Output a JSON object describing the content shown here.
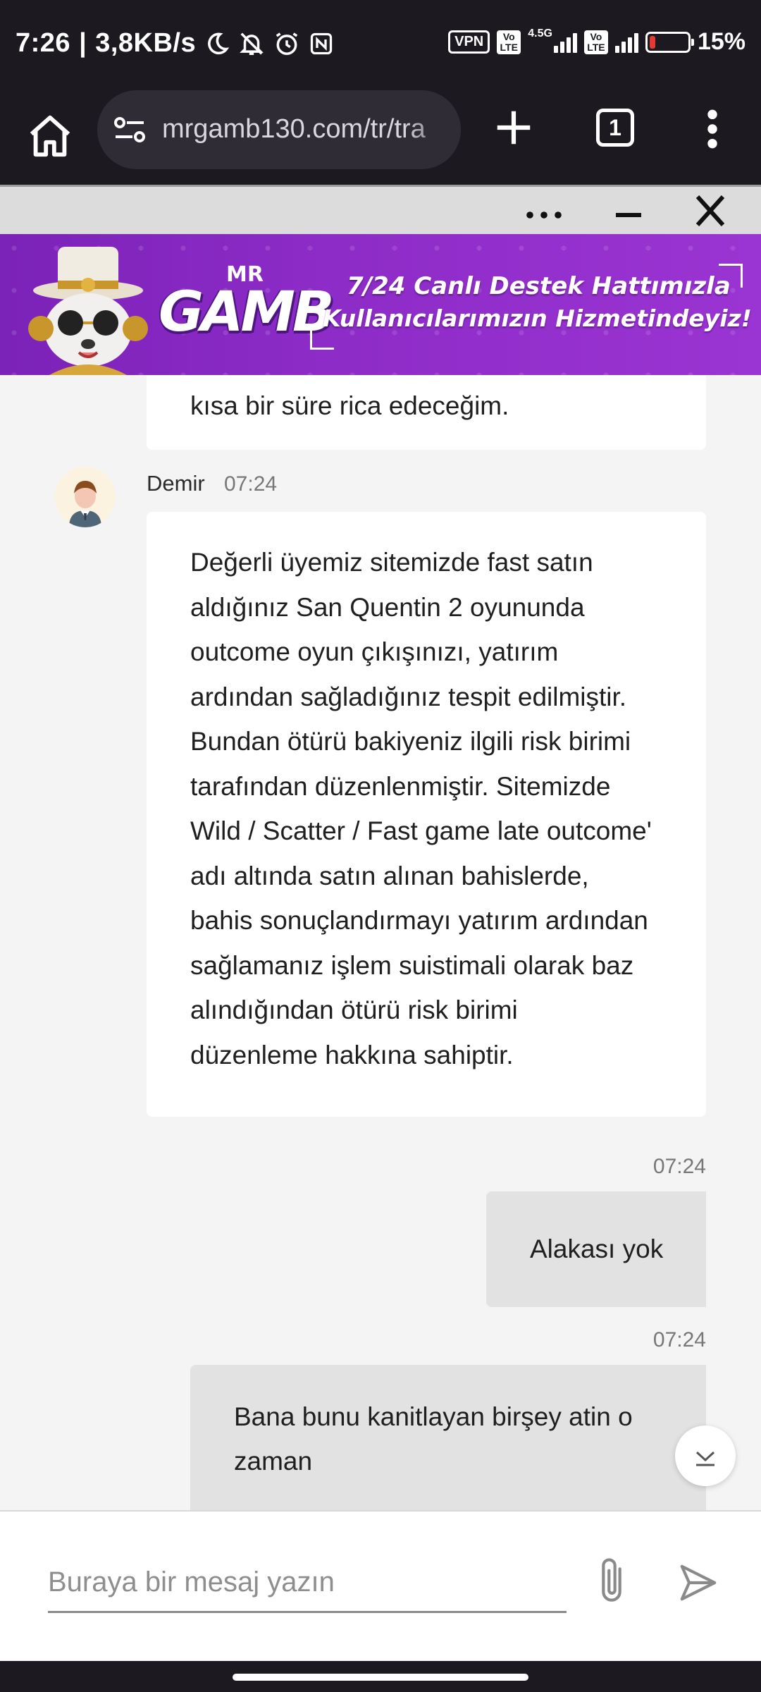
{
  "status_bar": {
    "time": "7:26",
    "speed": "3,8KB/s",
    "vpn": "VPN",
    "network_type": "4.5G",
    "volte": "Vo LTE",
    "battery_percent": "15%",
    "battery_level": 0.15,
    "icons": [
      "moon-icon",
      "mute-icon",
      "alarm-icon",
      "nfc-icon",
      "signal-icon",
      "battery-icon"
    ]
  },
  "browser": {
    "url": "mrgamb130.com/tr/tra",
    "tab_count": "1",
    "icons": [
      "home-icon",
      "site-settings-icon",
      "plus-icon",
      "tabs-icon",
      "more-vert-icon"
    ]
  },
  "widget_header": {
    "icons": [
      "more-horiz-icon",
      "minimize-icon",
      "close-icon"
    ]
  },
  "banner": {
    "logo_mr": "MR",
    "logo_gamb": "GAMB",
    "line1": "7/24 Canlı Destek Hattımızla",
    "line2": "Kullanıcılarımızın Hizmetindeyiz!",
    "accent_color": "#8e2cc8"
  },
  "chat": {
    "partial_message": "kısa bir süre rica edeceğim.",
    "agent": {
      "name": "Demir",
      "time": "07:24",
      "message_lines": [
        "Değerli üyemiz sitemizde fast satın",
        "aldığınız San Quentin 2 oyununda",
        "outcome oyun çıkışınızı, yatırım",
        "ardından sağladığınız tespit edilmiştir.",
        "Bundan ötürü bakiyeniz ilgili risk birimi",
        "tarafından düzenlenmiştir. Sitemizde",
        "Wild / Scatter / Fast game late outcome'",
        "adı altında satın alınan bahislerde,",
        "bahis sonuçlandırmayı yatırım ardından",
        "sağlamanız işlem suistimali olarak baz",
        "alındığından ötürü risk birimi",
        "düzenleme hakkına sahiptir."
      ]
    },
    "user_messages": [
      {
        "time": "07:24",
        "lines": [
          "Alakası yok"
        ]
      },
      {
        "time": "07:24",
        "lines": [
          "Bana bunu kanitlayan birşey atin o",
          "zaman"
        ]
      }
    ]
  },
  "input": {
    "placeholder": "Buraya bir mesaj yazın",
    "value": ""
  }
}
